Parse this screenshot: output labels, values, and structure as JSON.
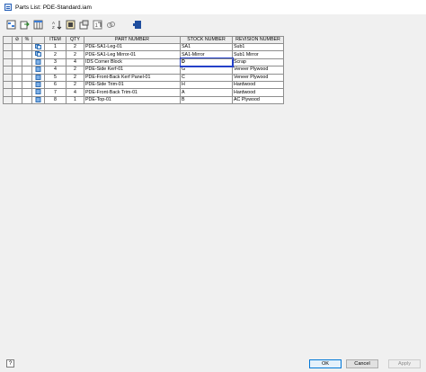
{
  "window": {
    "title": "Parts List: PDE-Standard.iam"
  },
  "toolbar": {
    "buttons": [
      "filter-settings-icon",
      "export-icon",
      "column-chooser-icon",
      "sort-icon",
      "group-settings-icon",
      "member-settings-icon",
      "renumber-icon",
      "links-icon",
      "bom-icon"
    ]
  },
  "table": {
    "headers": {
      "state": "",
      "override": "",
      "pct": "%",
      "icon": "",
      "item": "ITEM",
      "qty": "QTY",
      "part_number": "PART NUMBER",
      "stock_number": "STOCK NUMBER",
      "revision_number": "REVISION NUMBER"
    },
    "rows": [
      {
        "item": "1",
        "qty": "2",
        "part_number": "PDE-SA1-Leg-01",
        "stock_number": "SA1",
        "revision_number": "Sub1"
      },
      {
        "item": "2",
        "qty": "2",
        "part_number": "PDE-SA1-Leg Mirror-01",
        "stock_number": "SA1-Mirror",
        "revision_number": "Sub1 Mirror"
      },
      {
        "item": "3",
        "qty": "4",
        "part_number": "IDS Corner Block",
        "stock_number": "D",
        "revision_number": "Scrap"
      },
      {
        "item": "4",
        "qty": "2",
        "part_number": "PDE-Side Kerf-01",
        "stock_number": "G",
        "revision_number": "Veneer Plywood"
      },
      {
        "item": "5",
        "qty": "2",
        "part_number": "PDE-Front-Back Kerf Panel-01",
        "stock_number": "C",
        "revision_number": "Veneer Plywood"
      },
      {
        "item": "6",
        "qty": "2",
        "part_number": "PDE-Side Trim-01",
        "stock_number": "H",
        "revision_number": "Hardwood"
      },
      {
        "item": "7",
        "qty": "4",
        "part_number": "PDE-Front-Back Trim-01",
        "stock_number": "A",
        "revision_number": "Hardwood"
      },
      {
        "item": "8",
        "qty": "1",
        "part_number": "PDE-Top-01",
        "stock_number": "B",
        "revision_number": "AC Plywood"
      }
    ]
  },
  "footer": {
    "help_label": "?",
    "ok_label": "OK",
    "cancel_label": "Cancel",
    "apply_label": "Apply"
  },
  "colors": {
    "selection": "#2440c8",
    "ok_border": "#0078d7"
  }
}
